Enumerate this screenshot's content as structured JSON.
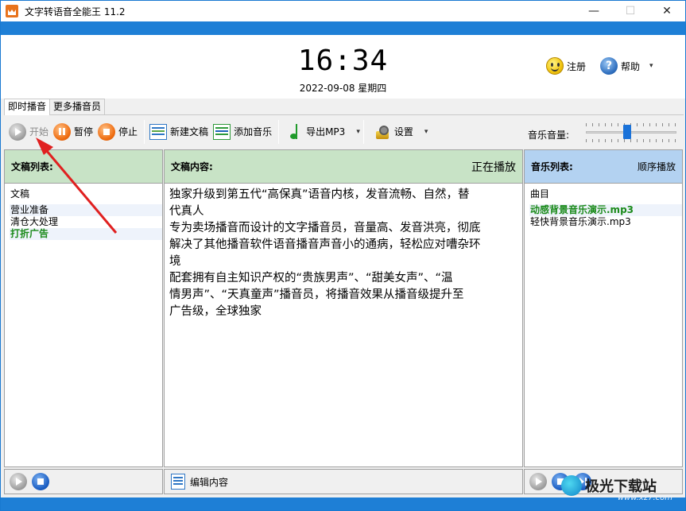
{
  "window": {
    "title": "文字转语音全能王 11.2",
    "minimize_glyph": "—",
    "maximize_glyph": "☐",
    "close_glyph": "✕"
  },
  "header": {
    "time": "16:34",
    "date": "2022-09-08 星期四",
    "register_label": "注册",
    "help_label": "帮助",
    "help_caret": "▾"
  },
  "tabs": [
    {
      "label": "即时播音",
      "active": true
    },
    {
      "label": "更多播音员",
      "active": false
    }
  ],
  "toolbar": {
    "start_label": "开始",
    "pause_label": "暂停",
    "stop_label": "停止",
    "new_doc_label": "新建文稿",
    "add_music_label": "添加音乐",
    "export_label": "导出MP3",
    "settings_label": "设置",
    "dropdown_glyph": "▾",
    "volume_label": "音乐音量:",
    "volume_level_percent": 45
  },
  "doc_panel": {
    "header": "文稿列表:",
    "column_header": "文稿",
    "items": [
      "营业准备",
      "清仓大处理",
      "打折广告"
    ],
    "playing_index": 2
  },
  "content_panel": {
    "header": "文稿内容:",
    "status": "正在播放",
    "lines": [
      "独家升级到第五代“高保真”语音内核，发音流畅、自然，替",
      "代真人",
      "专为卖场播音而设计的文字播音员，音量高、发音洪亮，彻底",
      "解决了其他播音软件语音播音声音小的通病，轻松应对嘈杂环",
      "境",
      "配套拥有自主知识产权的“贵族男声”、“甜美女声”、“温",
      "情男声”、“天真童声”播音员，将播音效果从播音级提升至",
      "广告级，全球独家"
    ],
    "edit_label": "编辑内容"
  },
  "music_panel": {
    "header": "音乐列表:",
    "mode": "顺序播放",
    "column_header": "曲目",
    "items": [
      "动感背景音乐演示.mp3",
      "轻快背景音乐演示.mp3"
    ],
    "playing_index": 0
  },
  "watermark": {
    "text": "极光下载站",
    "url": "www.xz7.com"
  },
  "colors": {
    "title_blue": "#1e7fd6",
    "doc_header_green": "#c8e3c6",
    "music_header_blue": "#b3d2f1",
    "playing_green": "#1a8a1a",
    "annotation_arrow_red": "#e02020"
  }
}
